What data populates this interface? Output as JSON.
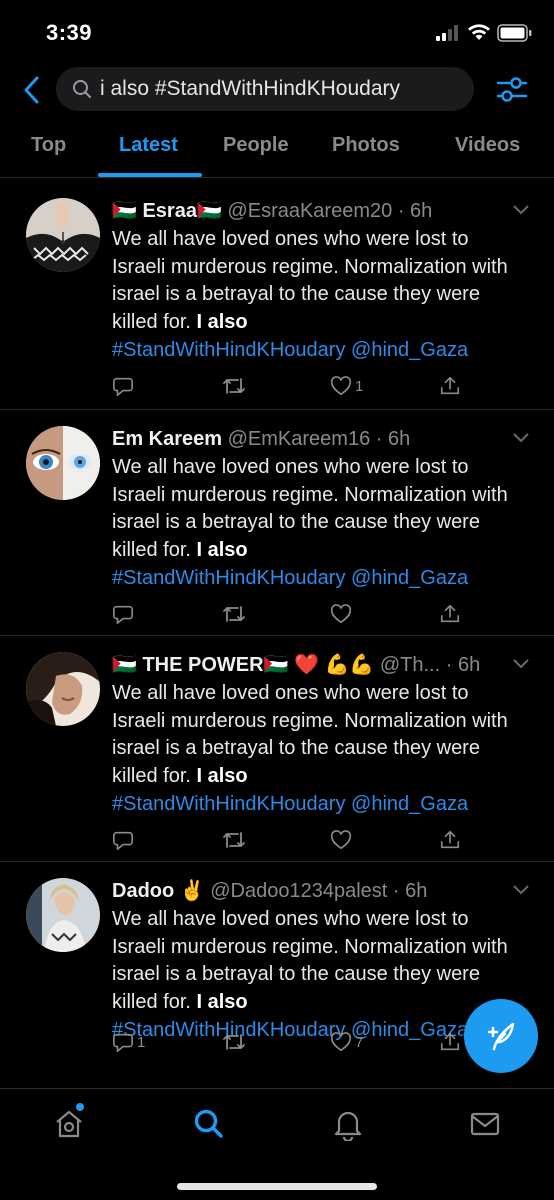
{
  "status_bar": {
    "time": "3:39"
  },
  "search": {
    "query": "i also #StandWithHindKHoudary"
  },
  "tabs": [
    {
      "label": "Top"
    },
    {
      "label": "Latest"
    },
    {
      "label": "People"
    },
    {
      "label": "Photos"
    },
    {
      "label": "Videos"
    }
  ],
  "active_tab": "Latest",
  "tweets": [
    {
      "name": "🇵🇸 Esraa🇵🇸",
      "handle": "@EsraaKareem20",
      "time": "· 6h",
      "text": "We all have loved ones who were lost to Israeli murderous regime. Normalization with israel is a betrayal to the cause they were killed for.",
      "bold": "I also",
      "hashtag": "#StandWithHindKHoudary",
      "mention": "@hind_Gaza",
      "replies": "",
      "retweets": "",
      "likes": "1"
    },
    {
      "name": "Em Kareem",
      "handle": "@EmKareem16",
      "time": "· 6h",
      "text": "We all have loved ones who were lost to Israeli murderous regime. Normalization with israel is a betrayal to the cause they were killed for.",
      "bold": "I also",
      "hashtag": "#StandWithHindKHoudary",
      "mention": "@hind_Gaza",
      "replies": "",
      "retweets": "",
      "likes": ""
    },
    {
      "name": "🇵🇸 THE POWER🇵🇸 ❤️ 💪💪",
      "handle": "@Th...",
      "time": "· 6h",
      "text": "We all have loved ones who were lost to Israeli murderous regime. Normalization with israel is a betrayal to the cause they were killed for.",
      "bold": "I also",
      "hashtag": "#StandWithHindKHoudary",
      "mention": "@hind_Gaza",
      "replies": "",
      "retweets": "",
      "likes": ""
    },
    {
      "name": "Dadoo ✌️",
      "handle": "@Dadoo1234palest",
      "time": "· 6h",
      "text": "We all have loved ones who were lost to Israeli murderous regime. Normalization with israel is a betrayal to the cause they were killed for.",
      "bold": "I also",
      "hashtag": "#StandWithHindKHoudary",
      "mention": "@hind_Gaza",
      "replies": "1",
      "retweets": "",
      "likes": "7"
    }
  ],
  "colors": {
    "accent": "#1d9bf0",
    "background": "#000000",
    "muted": "#8a8a8e"
  },
  "icons": {
    "back": "chevron-left-icon",
    "search": "search-icon",
    "filter": "filter-sliders-icon",
    "reply": "reply-icon",
    "retweet": "retweet-icon",
    "like": "heart-icon",
    "share": "share-icon",
    "more": "chevron-down-icon",
    "compose": "compose-tweet-icon",
    "home": "home-icon",
    "explore": "search-icon",
    "notifications": "bell-icon",
    "messages": "mail-icon"
  }
}
